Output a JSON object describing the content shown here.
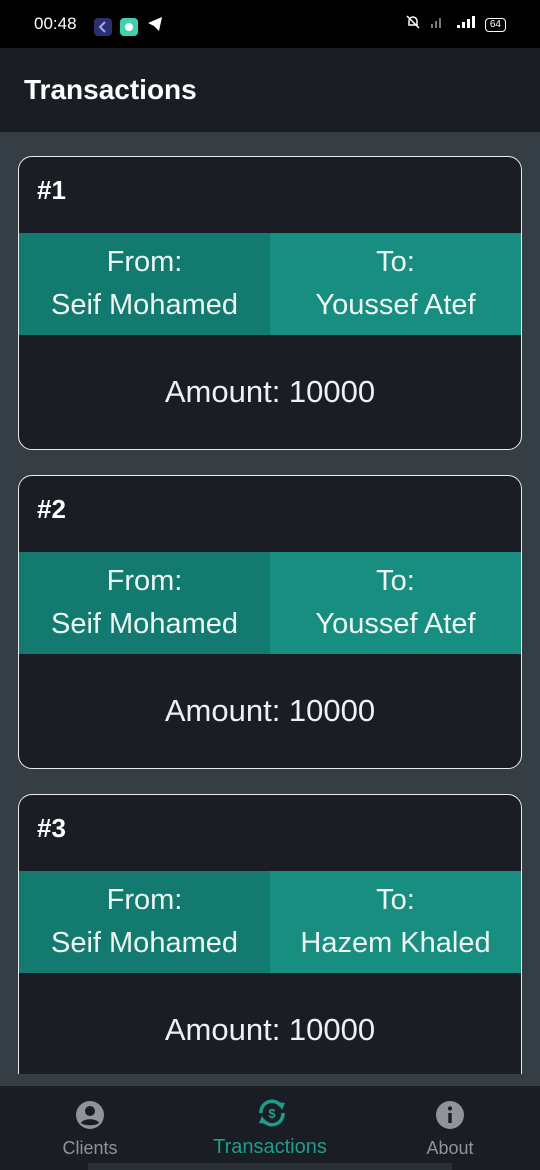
{
  "status_bar": {
    "time": "00:48",
    "battery": "64"
  },
  "app_bar": {
    "title": "Transactions"
  },
  "transactions": [
    {
      "number": "#1",
      "from_label": "From:",
      "from_name": "Seif Mohamed",
      "to_label": "To:",
      "to_name": "Youssef Atef",
      "amount": "Amount: 10000"
    },
    {
      "number": "#2",
      "from_label": "From:",
      "from_name": "Seif Mohamed",
      "to_label": "To:",
      "to_name": "Youssef Atef",
      "amount": "Amount: 10000"
    },
    {
      "number": "#3",
      "from_label": "From:",
      "from_name": "Seif Mohamed",
      "to_label": "To:",
      "to_name": "Hazem Khaled",
      "amount": "Amount: 10000"
    }
  ],
  "bottom_nav": {
    "items": [
      {
        "label": "Clients",
        "icon": "account-circle-icon"
      },
      {
        "label": "Transactions",
        "icon": "currency-exchange-icon"
      },
      {
        "label": "About",
        "icon": "info-icon"
      }
    ],
    "active_index": 1
  },
  "colors": {
    "accent": "#1f9d8c",
    "from_bg": "#127a6e",
    "to_bg": "#178e80",
    "card_bg": "#1a1d23",
    "page_bg": "#343e44"
  }
}
